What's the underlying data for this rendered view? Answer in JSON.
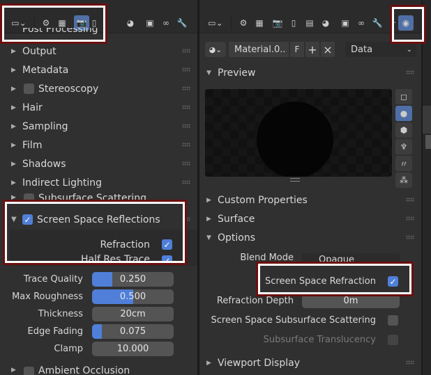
{
  "left_panel": {
    "partial_top_label": "Post Processing",
    "sections": [
      {
        "label": "Output",
        "checkbox": false
      },
      {
        "label": "Metadata",
        "checkbox": false
      },
      {
        "label": "Stereoscopy",
        "checkbox": true
      },
      {
        "label": "Hair",
        "checkbox": false
      },
      {
        "label": "Sampling",
        "checkbox": false
      },
      {
        "label": "Film",
        "checkbox": false
      },
      {
        "label": "Shadows",
        "checkbox": false
      },
      {
        "label": "Indirect Lighting",
        "checkbox": false
      },
      {
        "label": "Subsurface Scattering",
        "checkbox": true
      }
    ],
    "ssr": {
      "label": "Screen Space Reflections",
      "enabled": true,
      "refraction_label": "Refraction",
      "half_res_label": "Half Res Trace"
    },
    "fields": [
      {
        "label": "Trace Quality",
        "value": "0.250",
        "fill": 0.25
      },
      {
        "label": "Max Roughness",
        "value": "0.500",
        "fill": 0.5
      },
      {
        "label": "Thickness",
        "value": "20cm",
        "fill": 0
      },
      {
        "label": "Edge Fading",
        "value": "0.075",
        "fill": 0.075
      },
      {
        "label": "Clamp",
        "value": "10.000",
        "fill": 0
      }
    ],
    "partial_bottom_label": "Ambient Occlusion"
  },
  "right_panel": {
    "material_name": "Material.0..",
    "fake_user": "F",
    "add": "+",
    "remove": "×",
    "data_dropdown": "Data",
    "preview_label": "Preview",
    "sections": [
      "Custom Properties",
      "Surface",
      "Options"
    ],
    "blend_mode_label": "Blend Mode",
    "blend_mode_value": "Opaque",
    "ssrefraction_label": "Screen Space Refraction",
    "refraction_depth_label": "Refraction Depth",
    "refraction_depth_value": "0m",
    "sss_label": "Screen Space Subsurface Scattering",
    "sst_label": "Subsurface Translucency",
    "viewport_display_label": "Viewport Display"
  },
  "colors": {
    "accent": "#4f7fd9",
    "highlight_border": "#ffffff",
    "highlight_outline": "#6b0f0f"
  }
}
